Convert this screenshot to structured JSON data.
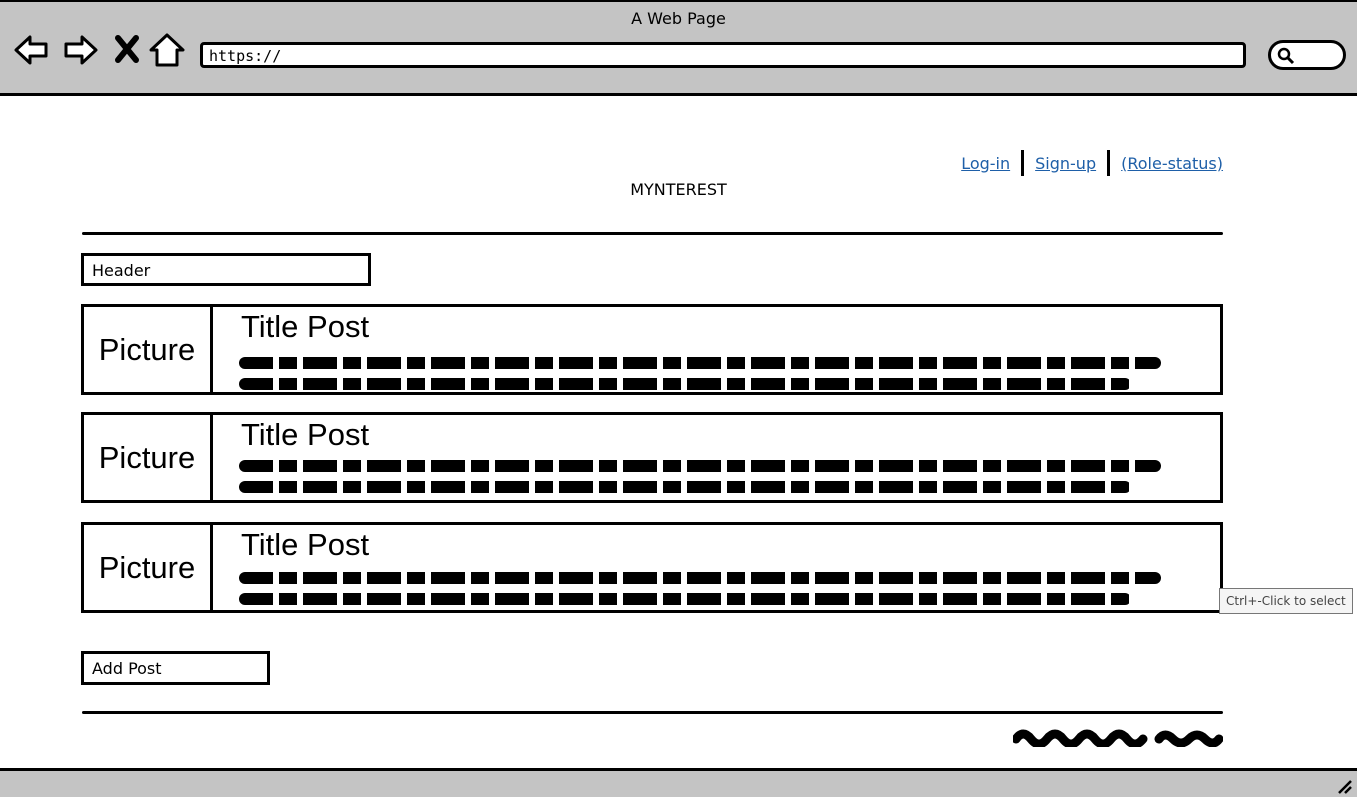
{
  "browser": {
    "title": "A Web Page",
    "url": "https://",
    "icons": [
      "back-arrow-icon",
      "forward-arrow-icon",
      "close-x-icon",
      "home-icon",
      "search-icon"
    ]
  },
  "top_links": {
    "login": "Log-in",
    "signup": "Sign-up",
    "role_status": "(Role-status)"
  },
  "brand": "MYNTEREST",
  "header_field": "Header",
  "posts": [
    {
      "picture": "Picture",
      "title": "Title Post"
    },
    {
      "picture": "Picture",
      "title": "Title Post"
    },
    {
      "picture": "Picture",
      "title": "Title Post"
    }
  ],
  "add_post": "Add Post",
  "tooltip": "Ctrl+-Click to select",
  "colors": {
    "chrome": "#c4c4c4",
    "link": "#1e5fa8"
  }
}
